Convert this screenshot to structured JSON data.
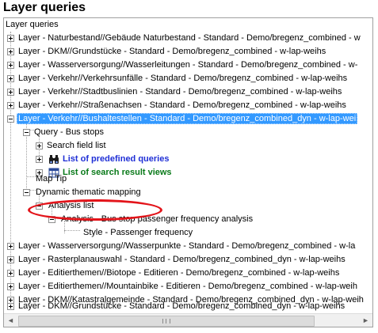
{
  "window_title": "Layer queries",
  "tree": {
    "root": "Layer queries",
    "layers_top": [
      "Layer - Naturbestand//Gebäude Naturbestand - Standard - Demo/bregenz_combined - w",
      "Layer - DKM//Grundstücke - Standard - Demo/bregenz_combined - w-lap-weihs",
      "Layer - Wasserversorgung//Wasserleitungen - Standard - Demo/bregenz_combined - w-",
      "Layer - Verkehr//Verkehrsunfälle - Standard - Demo/bregenz_combined - w-lap-weihs",
      "Layer - Verkehr//Stadtbuslinien - Standard - Demo/bregenz_combined - w-lap-weihs",
      "Layer - Verkehr//Straßenachsen - Standard - Demo/bregenz_combined - w-lap-weihs"
    ],
    "selected_layer": "Layer - Verkehr//Bushaltestellen - Standard - Demo/bregenz_combined_dyn - w-lap-wei",
    "query": "Query - Bus stops",
    "search_field_list": "Search field list",
    "predefined_queries": "List of predefined queries",
    "search_result_views": "List of search result views",
    "map_tip": "Map Tip",
    "dynamic_mapping": "Dynamic thematic mapping",
    "analysis_list": "Analysis list",
    "analysis": "Analysis - Bus stop passenger frequency analysis",
    "style": "Style - Passenger frequency",
    "layers_bottom": [
      "Layer - Wasserversorgung//Wasserpunkte - Standard - Demo/bregenz_combined - w-la",
      "Layer - Rasterplanauswahl - Standard - Demo/bregenz_combined_dyn - w-lap-weihs",
      "Layer - Editierthemen//Biotope - Editieren - Demo/bregenz_combined - w-lap-weihs",
      "Layer - Editierthemen//Mountainbike - Editieren - Demo/bregenz_combined - w-lap-weih",
      "Layer - DKM//Katastralgemeinde - Standard - Demo/bregenz_combined_dyn - w-lap-weih",
      "Layer - DKM//Grundstücke - Standard - Demo/bregenz_combined_dyn - w-lap-weihs"
    ]
  },
  "scrollbar": {
    "left_arrow": "◄",
    "right_arrow": "►"
  },
  "colors": {
    "selection": "#3399ff",
    "link_blue": "#1f2fd6",
    "link_green": "#0a7a1a",
    "annotation": "#e3141a"
  }
}
